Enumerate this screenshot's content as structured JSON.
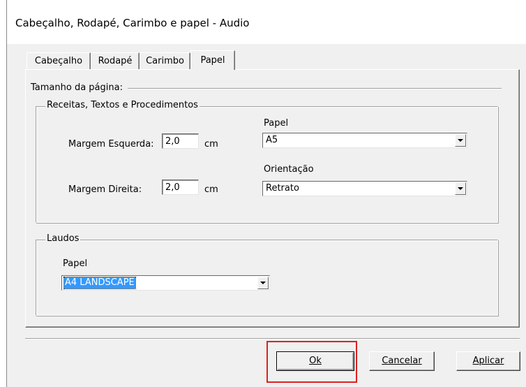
{
  "window": {
    "title": "Cabeçalho, Rodapé, Carimbo e papel - Audio"
  },
  "tabs": [
    {
      "label": "Cabeçalho",
      "active": false
    },
    {
      "label": "Rodapé",
      "active": false
    },
    {
      "label": "Carimbo",
      "active": false
    },
    {
      "label": "Papel",
      "active": true
    }
  ],
  "papel_tab": {
    "page_size_label": "Tamanho da página:",
    "receitas_group": {
      "title": "Receitas, Textos e Procedimentos",
      "margem_esquerda_label": "Margem Esquerda:",
      "margem_esquerda_value": "2,0",
      "margem_esquerda_unit": "cm",
      "margem_direita_label": "Margem Direita:",
      "margem_direita_value": "2,0",
      "margem_direita_unit": "cm",
      "papel_label": "Papel",
      "papel_value": "A5",
      "orientacao_label": "Orientação",
      "orientacao_value": "Retrato"
    },
    "laudos_group": {
      "title": "Laudos",
      "papel_label": "Papel",
      "papel_value": "A4 LANDSCAPE"
    }
  },
  "buttons": {
    "ok_label": "Ok",
    "cancelar_label": "Cancelar",
    "aplicar_label": "Aplicar"
  },
  "highlight_color": "#e02020"
}
